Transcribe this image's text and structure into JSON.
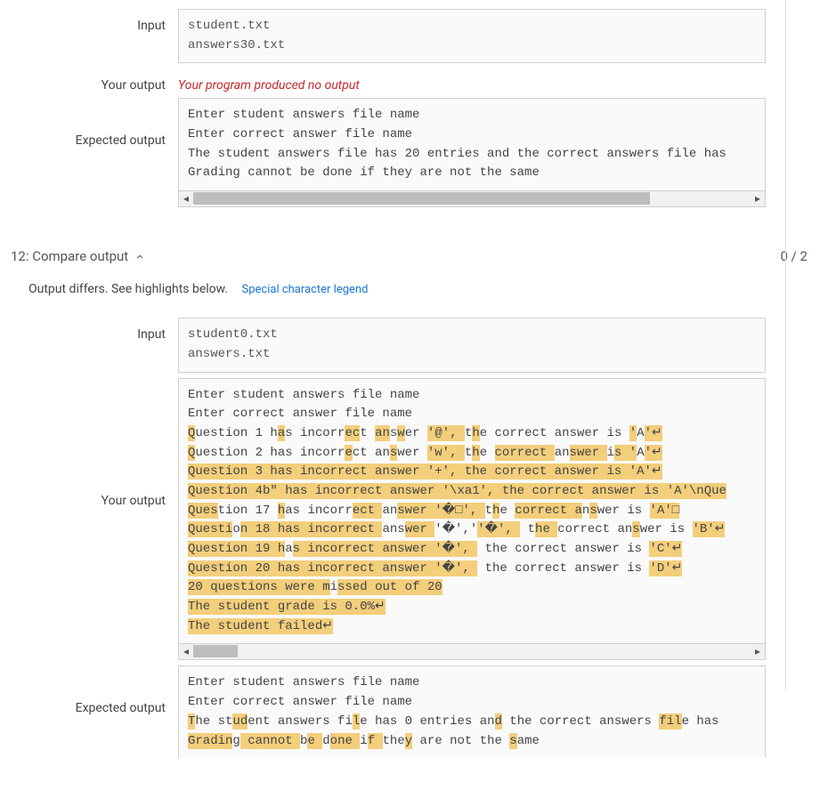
{
  "labels": {
    "input": "Input",
    "your_output": "Your output",
    "expected_output": "Expected output"
  },
  "test11": {
    "input_lines": [
      "student.txt",
      "answers30.txt"
    ],
    "no_output_msg": "Your program produced no output",
    "expected_lines": [
      "Enter student answers file name",
      "Enter correct answer file name",
      "The student answers file has 20 entries and the correct answers file has",
      "Grading cannot be done if they are not the same"
    ]
  },
  "test12": {
    "header_title": "12: Compare output",
    "score": "0 / 2",
    "diff_message": "Output differs. See highlights below.",
    "legend_link": "Special character legend",
    "input_lines": [
      "student0.txt",
      "answers.txt"
    ],
    "your_output_lines": [
      {
        "plain": "Enter student answers file name"
      },
      {
        "plain": "Enter correct answer file name"
      },
      {
        "segments": [
          {
            "t": "Q",
            "h": 1
          },
          {
            "t": "uestion 1 h"
          },
          {
            "t": "a",
            "h": 1
          },
          {
            "t": "s incorr"
          },
          {
            "t": "ec",
            "h": 1
          },
          {
            "t": "t "
          },
          {
            "t": "an",
            "h": 1
          },
          {
            "t": "s"
          },
          {
            "t": "w",
            "h": 1
          },
          {
            "t": "er "
          },
          {
            "t": "'@', ",
            "h": 1
          },
          {
            "t": "t"
          },
          {
            "t": "h",
            "h": 1
          },
          {
            "t": "e correct answer is "
          },
          {
            "t": "'",
            "h": 1
          },
          {
            "t": "A"
          },
          {
            "t": "'↵",
            "h": 1
          }
        ]
      },
      {
        "segments": [
          {
            "t": "Q",
            "h": 1
          },
          {
            "t": "uestion 2 has incorr"
          },
          {
            "t": "e",
            "h": 1
          },
          {
            "t": "ct an"
          },
          {
            "t": "s",
            "h": 1
          },
          {
            "t": "wer "
          },
          {
            "t": "'w', ",
            "h": 1
          },
          {
            "t": "t"
          },
          {
            "t": "h",
            "h": 1
          },
          {
            "t": "e "
          },
          {
            "t": "correct ",
            "h": 1
          },
          {
            "t": "an"
          },
          {
            "t": "swer ",
            "h": 1
          },
          {
            "t": "i"
          },
          {
            "t": "s ",
            "h": 1
          },
          {
            "t": "'",
            "h": 1
          },
          {
            "t": "A"
          },
          {
            "t": "'↵",
            "h": 1
          }
        ]
      },
      {
        "segments": [
          {
            "t": "Question 3 has incorrect answer '+', the correct answer is 'A'",
            "h": 1
          },
          {
            "t": "↵",
            "h": 1
          }
        ]
      },
      {
        "segments": [
          {
            "t": "Question 4b\" has incorrect answer '\\xa1', the correct answer is 'A'\\nQue",
            "h": 1
          }
        ]
      },
      {
        "segments": [
          {
            "t": "Ques",
            "h": 1
          },
          {
            "t": "tion 17 "
          },
          {
            "t": "h",
            "h": 1
          },
          {
            "t": "as incorr"
          },
          {
            "t": "ect ",
            "h": 1
          },
          {
            "t": "an"
          },
          {
            "t": "swer ",
            "h": 1
          },
          {
            "t": "'�□', ",
            "h": 1
          },
          {
            "t": "t"
          },
          {
            "t": "h",
            "h": 1
          },
          {
            "t": "e "
          },
          {
            "t": "correct a",
            "h": 1
          },
          {
            "t": "n"
          },
          {
            "t": "s",
            "h": 1
          },
          {
            "t": "wer is "
          },
          {
            "t": "'A'□",
            "h": 1
          }
        ]
      },
      {
        "segments": [
          {
            "t": "Questi",
            "h": 1
          },
          {
            "t": "o"
          },
          {
            "t": "n 18 has incorrect ",
            "h": 1
          },
          {
            "t": "ans"
          },
          {
            "t": "wer ",
            "h": 1
          },
          {
            "t": "'�','",
            "h": 0
          },
          {
            "t": "'�', ",
            "h": 1
          },
          {
            "t": " t"
          },
          {
            "t": "he ",
            "h": 1
          },
          {
            "t": "correct an"
          },
          {
            "t": "s",
            "h": 1
          },
          {
            "t": "wer is "
          },
          {
            "t": "'B'↵",
            "h": 1
          }
        ]
      },
      {
        "segments": [
          {
            "t": "Question 19 h",
            "h": 1
          },
          {
            "t": "a"
          },
          {
            "t": "s incorrect answer ",
            "h": 1
          },
          {
            "t": "'�', ",
            "h": 1
          },
          {
            "t": " the correct answer is "
          },
          {
            "t": "'C'↵",
            "h": 1
          }
        ]
      },
      {
        "segments": [
          {
            "t": "Question 20 has incorrect answer ",
            "h": 1
          },
          {
            "t": "'�', ",
            "h": 1
          },
          {
            "t": " the correct answer is "
          },
          {
            "t": "'D'↵",
            "h": 1
          }
        ]
      },
      {
        "segments": [
          {
            "t": "20 questions were m",
            "h": 1
          },
          {
            "t": "i"
          },
          {
            "t": "ss",
            "h": 1
          },
          {
            "t": "ed out of 20",
            "h": 1
          }
        ]
      },
      {
        "segments": [
          {
            "t": "The student grade is 0.0%",
            "h": 1
          },
          {
            "t": "↵",
            "h": 1
          }
        ]
      },
      {
        "segments": [
          {
            "t": "The student failed",
            "h": 1
          },
          {
            "t": "↵",
            "h": 1
          }
        ]
      }
    ],
    "expected_lines_seg": [
      {
        "plain": "Enter student answers file name"
      },
      {
        "plain": "Enter correct answer file name"
      },
      {
        "segments": [
          {
            "t": "T",
            "h": 1
          },
          {
            "t": "he st"
          },
          {
            "t": "ud",
            "h": 1
          },
          {
            "t": "ent answers fi"
          },
          {
            "t": "l",
            "h": 1
          },
          {
            "t": "e has 0 entries an"
          },
          {
            "t": "d",
            "h": 1
          },
          {
            "t": " the correct answers "
          },
          {
            "t": "fil",
            "h": 1
          },
          {
            "t": "e has"
          }
        ]
      },
      {
        "segments": [
          {
            "t": "Gradin",
            "h": 1
          },
          {
            "t": "g"
          },
          {
            "t": " cannot ",
            "h": 1
          },
          {
            "t": "b"
          },
          {
            "t": "e ",
            "h": 1
          },
          {
            "t": "d"
          },
          {
            "t": "one ",
            "h": 1
          },
          {
            "t": "i"
          },
          {
            "t": "f ",
            "h": 1
          },
          {
            "t": "the"
          },
          {
            "t": "y",
            "h": 1
          },
          {
            "t": " are not the "
          },
          {
            "t": "s",
            "h": 1
          },
          {
            "t": "ame"
          }
        ]
      }
    ]
  }
}
